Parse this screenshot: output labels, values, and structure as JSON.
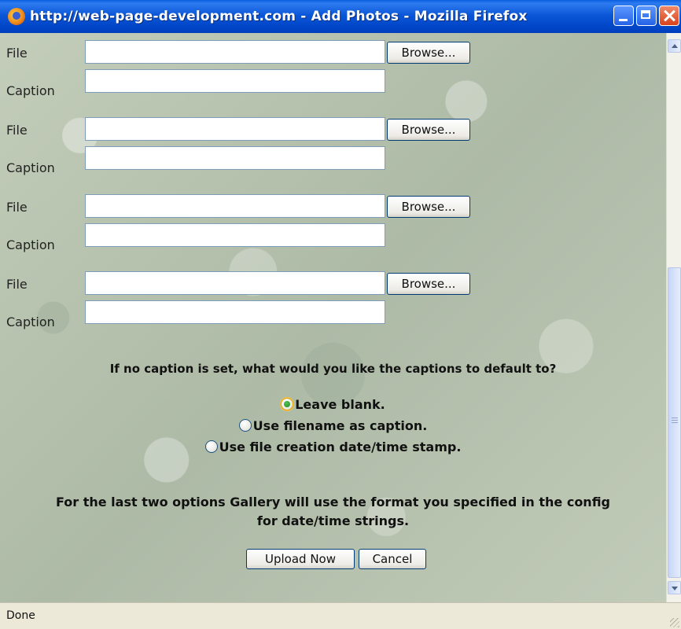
{
  "window": {
    "title": "http://web-page-development.com - Add Photos - Mozilla Firefox"
  },
  "form": {
    "file_label": "File",
    "caption_label": "Caption",
    "browse_label": "Browse...",
    "rows": [
      {
        "file_value": "",
        "caption_value": ""
      },
      {
        "file_value": "",
        "caption_value": ""
      },
      {
        "file_value": "",
        "caption_value": ""
      },
      {
        "file_value": "",
        "caption_value": ""
      }
    ],
    "question": "If no caption is set, what would you like the captions to default to?",
    "options": [
      {
        "label": "Leave blank.",
        "checked": true
      },
      {
        "label": "Use filename as caption.",
        "checked": false
      },
      {
        "label": "Use file creation date/time stamp.",
        "checked": false
      }
    ],
    "note_line1": "For the last two options Gallery will use the format you specified in the config",
    "note_line2": "for date/time strings.",
    "upload_label": "Upload Now",
    "cancel_label": "Cancel"
  },
  "status": {
    "text": "Done"
  }
}
